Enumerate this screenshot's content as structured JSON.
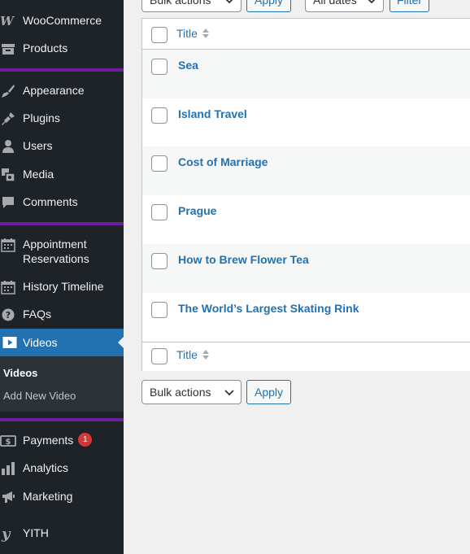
{
  "sidebar": {
    "items": [
      {
        "label": "WooCommerce",
        "icon": "woocommerce-icon"
      },
      {
        "label": "Products",
        "icon": "archive-icon"
      },
      {
        "label": "Appearance",
        "icon": "paintbrush-icon"
      },
      {
        "label": "Plugins",
        "icon": "plugin-icon"
      },
      {
        "label": "Users",
        "icon": "user-icon"
      },
      {
        "label": "Media",
        "icon": "media-icon"
      },
      {
        "label": "Comments",
        "icon": "comment-icon"
      },
      {
        "label": "Appointment Reservations",
        "icon": "calendar-icon"
      },
      {
        "label": "History Timeline",
        "icon": "calendar-icon"
      },
      {
        "label": "FAQs",
        "icon": "help-icon"
      },
      {
        "label": "Videos",
        "icon": "video-icon"
      },
      {
        "label": "Payments",
        "icon": "payment-icon",
        "badge": "1"
      },
      {
        "label": "Analytics",
        "icon": "chart-bar-icon"
      },
      {
        "label": "Marketing",
        "icon": "megaphone-icon"
      },
      {
        "label": "YITH",
        "icon": "yith-icon"
      }
    ],
    "submenu": {
      "current": "Videos",
      "add_new": "Add New Video"
    }
  },
  "top_controls": {
    "bulk_actions": "Bulk actions",
    "apply": "Apply",
    "dates": "All dates",
    "filter": "Filter"
  },
  "table": {
    "column_title": "Title",
    "rows": [
      "Sea",
      "Island Travel",
      "Cost of Marriage",
      "Prague",
      "How to Brew Flower Tea",
      "The World’s Largest Skating Rink"
    ]
  },
  "bottom_controls": {
    "bulk_actions": "Bulk actions",
    "apply": "Apply"
  },
  "colors": {
    "sidebar_bg": "#1d2327",
    "separator": "#6b1e9f",
    "active": "#2271b1",
    "link": "#2271b1",
    "badge": "#d63638"
  }
}
